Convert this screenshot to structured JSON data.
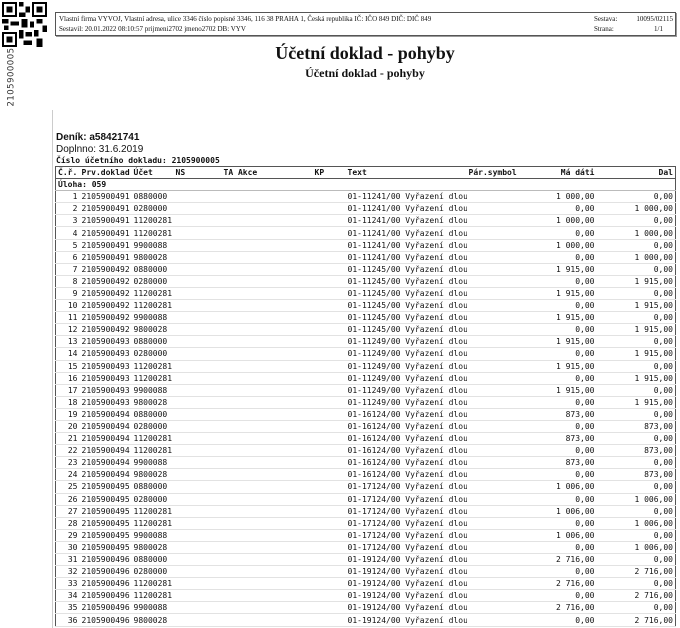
{
  "header": {
    "line1": "Vlastní firma VYVOJ, Vlastní adresa, ulice 3346 číslo popisné 3346, 116 38 PRAHA 1, Česká republika  IČ: IČO 849  DIČ: DIČ 849",
    "line2": "Sestavil: 20.01.2022 08:10:57 prijmeni2702 jmeno2702  DB: VYV",
    "sestava_label": "Sestava:",
    "sestava_value": "10095/02115",
    "strana_label": "Strana:",
    "strana_value": "1/1"
  },
  "side_code": "2105900005",
  "title": "Účetní doklad - pohyby",
  "subtitle": "Účetní doklad - pohyby",
  "denik": "Deník: a58421741",
  "doplnno": "Doplnno: 31.6.2019",
  "cislo": "Číslo účetního dokladu: 2105900005",
  "columns": [
    "Č.ř.",
    "Prv.doklad",
    "Účet",
    "NS",
    "TA Akce",
    "KP",
    "Text",
    "Pár.symbol",
    "Má dáti",
    "Dal"
  ],
  "uloha": "Úloha: 059",
  "rows": [
    [
      "1",
      "2105900491",
      "0880000",
      "01-11241/00 Vyřazení dlou",
      "1 000,00",
      "0,00"
    ],
    [
      "2",
      "2105900491",
      "0280000",
      "01-11241/00 Vyřazení dlou",
      "0,00",
      "1 000,00"
    ],
    [
      "3",
      "2105900491",
      "11200281",
      "01-11241/00 Vyřazení dlou",
      "1 000,00",
      "0,00"
    ],
    [
      "4",
      "2105900491",
      "11200281",
      "01-11241/00 Vyřazení dlou",
      "0,00",
      "1 000,00"
    ],
    [
      "5",
      "2105900491",
      "9900088",
      "01-11241/00 Vyřazení dlou",
      "1 000,00",
      "0,00"
    ],
    [
      "6",
      "2105900491",
      "9800028",
      "01-11241/00 Vyřazení dlou",
      "0,00",
      "1 000,00"
    ],
    [
      "7",
      "2105900492",
      "0880000",
      "01-11245/00 Vyřazení dlou",
      "1 915,00",
      "0,00"
    ],
    [
      "8",
      "2105900492",
      "0280000",
      "01-11245/00 Vyřazení dlou",
      "0,00",
      "1 915,00"
    ],
    [
      "9",
      "2105900492",
      "11200281",
      "01-11245/00 Vyřazení dlou",
      "1 915,00",
      "0,00"
    ],
    [
      "10",
      "2105900492",
      "11200281",
      "01-11245/00 Vyřazení dlou",
      "0,00",
      "1 915,00"
    ],
    [
      "11",
      "2105900492",
      "9900088",
      "01-11245/00 Vyřazení dlou",
      "1 915,00",
      "0,00"
    ],
    [
      "12",
      "2105900492",
      "9800028",
      "01-11245/00 Vyřazení dlou",
      "0,00",
      "1 915,00"
    ],
    [
      "13",
      "2105900493",
      "0880000",
      "01-11249/00 Vyřazení dlou",
      "1 915,00",
      "0,00"
    ],
    [
      "14",
      "2105900493",
      "0280000",
      "01-11249/00 Vyřazení dlou",
      "0,00",
      "1 915,00"
    ],
    [
      "15",
      "2105900493",
      "11200281",
      "01-11249/00 Vyřazení dlou",
      "1 915,00",
      "0,00"
    ],
    [
      "16",
      "2105900493",
      "11200281",
      "01-11249/00 Vyřazení dlou",
      "0,00",
      "1 915,00"
    ],
    [
      "17",
      "2105900493",
      "9900088",
      "01-11249/00 Vyřazení dlou",
      "1 915,00",
      "0,00"
    ],
    [
      "18",
      "2105900493",
      "9800028",
      "01-11249/00 Vyřazení dlou",
      "0,00",
      "1 915,00"
    ],
    [
      "19",
      "2105900494",
      "0880000",
      "01-16124/00 Vyřazení dlou",
      "873,00",
      "0,00"
    ],
    [
      "20",
      "2105900494",
      "0280000",
      "01-16124/00 Vyřazení dlou",
      "0,00",
      "873,00"
    ],
    [
      "21",
      "2105900494",
      "11200281",
      "01-16124/00 Vyřazení dlou",
      "873,00",
      "0,00"
    ],
    [
      "22",
      "2105900494",
      "11200281",
      "01-16124/00 Vyřazení dlou",
      "0,00",
      "873,00"
    ],
    [
      "23",
      "2105900494",
      "9900088",
      "01-16124/00 Vyřazení dlou",
      "873,00",
      "0,00"
    ],
    [
      "24",
      "2105900494",
      "9800028",
      "01-16124/00 Vyřazení dlou",
      "0,00",
      "873,00"
    ],
    [
      "25",
      "2105900495",
      "0880000",
      "01-17124/00 Vyřazení dlou",
      "1 006,00",
      "0,00"
    ],
    [
      "26",
      "2105900495",
      "0280000",
      "01-17124/00 Vyřazení dlou",
      "0,00",
      "1 006,00"
    ],
    [
      "27",
      "2105900495",
      "11200281",
      "01-17124/00 Vyřazení dlou",
      "1 006,00",
      "0,00"
    ],
    [
      "28",
      "2105900495",
      "11200281",
      "01-17124/00 Vyřazení dlou",
      "0,00",
      "1 006,00"
    ],
    [
      "29",
      "2105900495",
      "9900088",
      "01-17124/00 Vyřazení dlou",
      "1 006,00",
      "0,00"
    ],
    [
      "30",
      "2105900495",
      "9800028",
      "01-17124/00 Vyřazení dlou",
      "0,00",
      "1 006,00"
    ],
    [
      "31",
      "2105900496",
      "0880000",
      "01-19124/00 Vyřazení dlou",
      "2 716,00",
      "0,00"
    ],
    [
      "32",
      "2105900496",
      "0280000",
      "01-19124/00 Vyřazení dlou",
      "0,00",
      "2 716,00"
    ],
    [
      "33",
      "2105900496",
      "11200281",
      "01-19124/00 Vyřazení dlou",
      "2 716,00",
      "0,00"
    ],
    [
      "34",
      "2105900496",
      "11200281",
      "01-19124/00 Vyřazení dlou",
      "0,00",
      "2 716,00"
    ],
    [
      "35",
      "2105900496",
      "9900088",
      "01-19124/00 Vyřazení dlou",
      "2 716,00",
      "0,00"
    ],
    [
      "36",
      "2105900496",
      "9800028",
      "01-19124/00 Vyřazení dlou",
      "0,00",
      "2 716,00"
    ]
  ]
}
